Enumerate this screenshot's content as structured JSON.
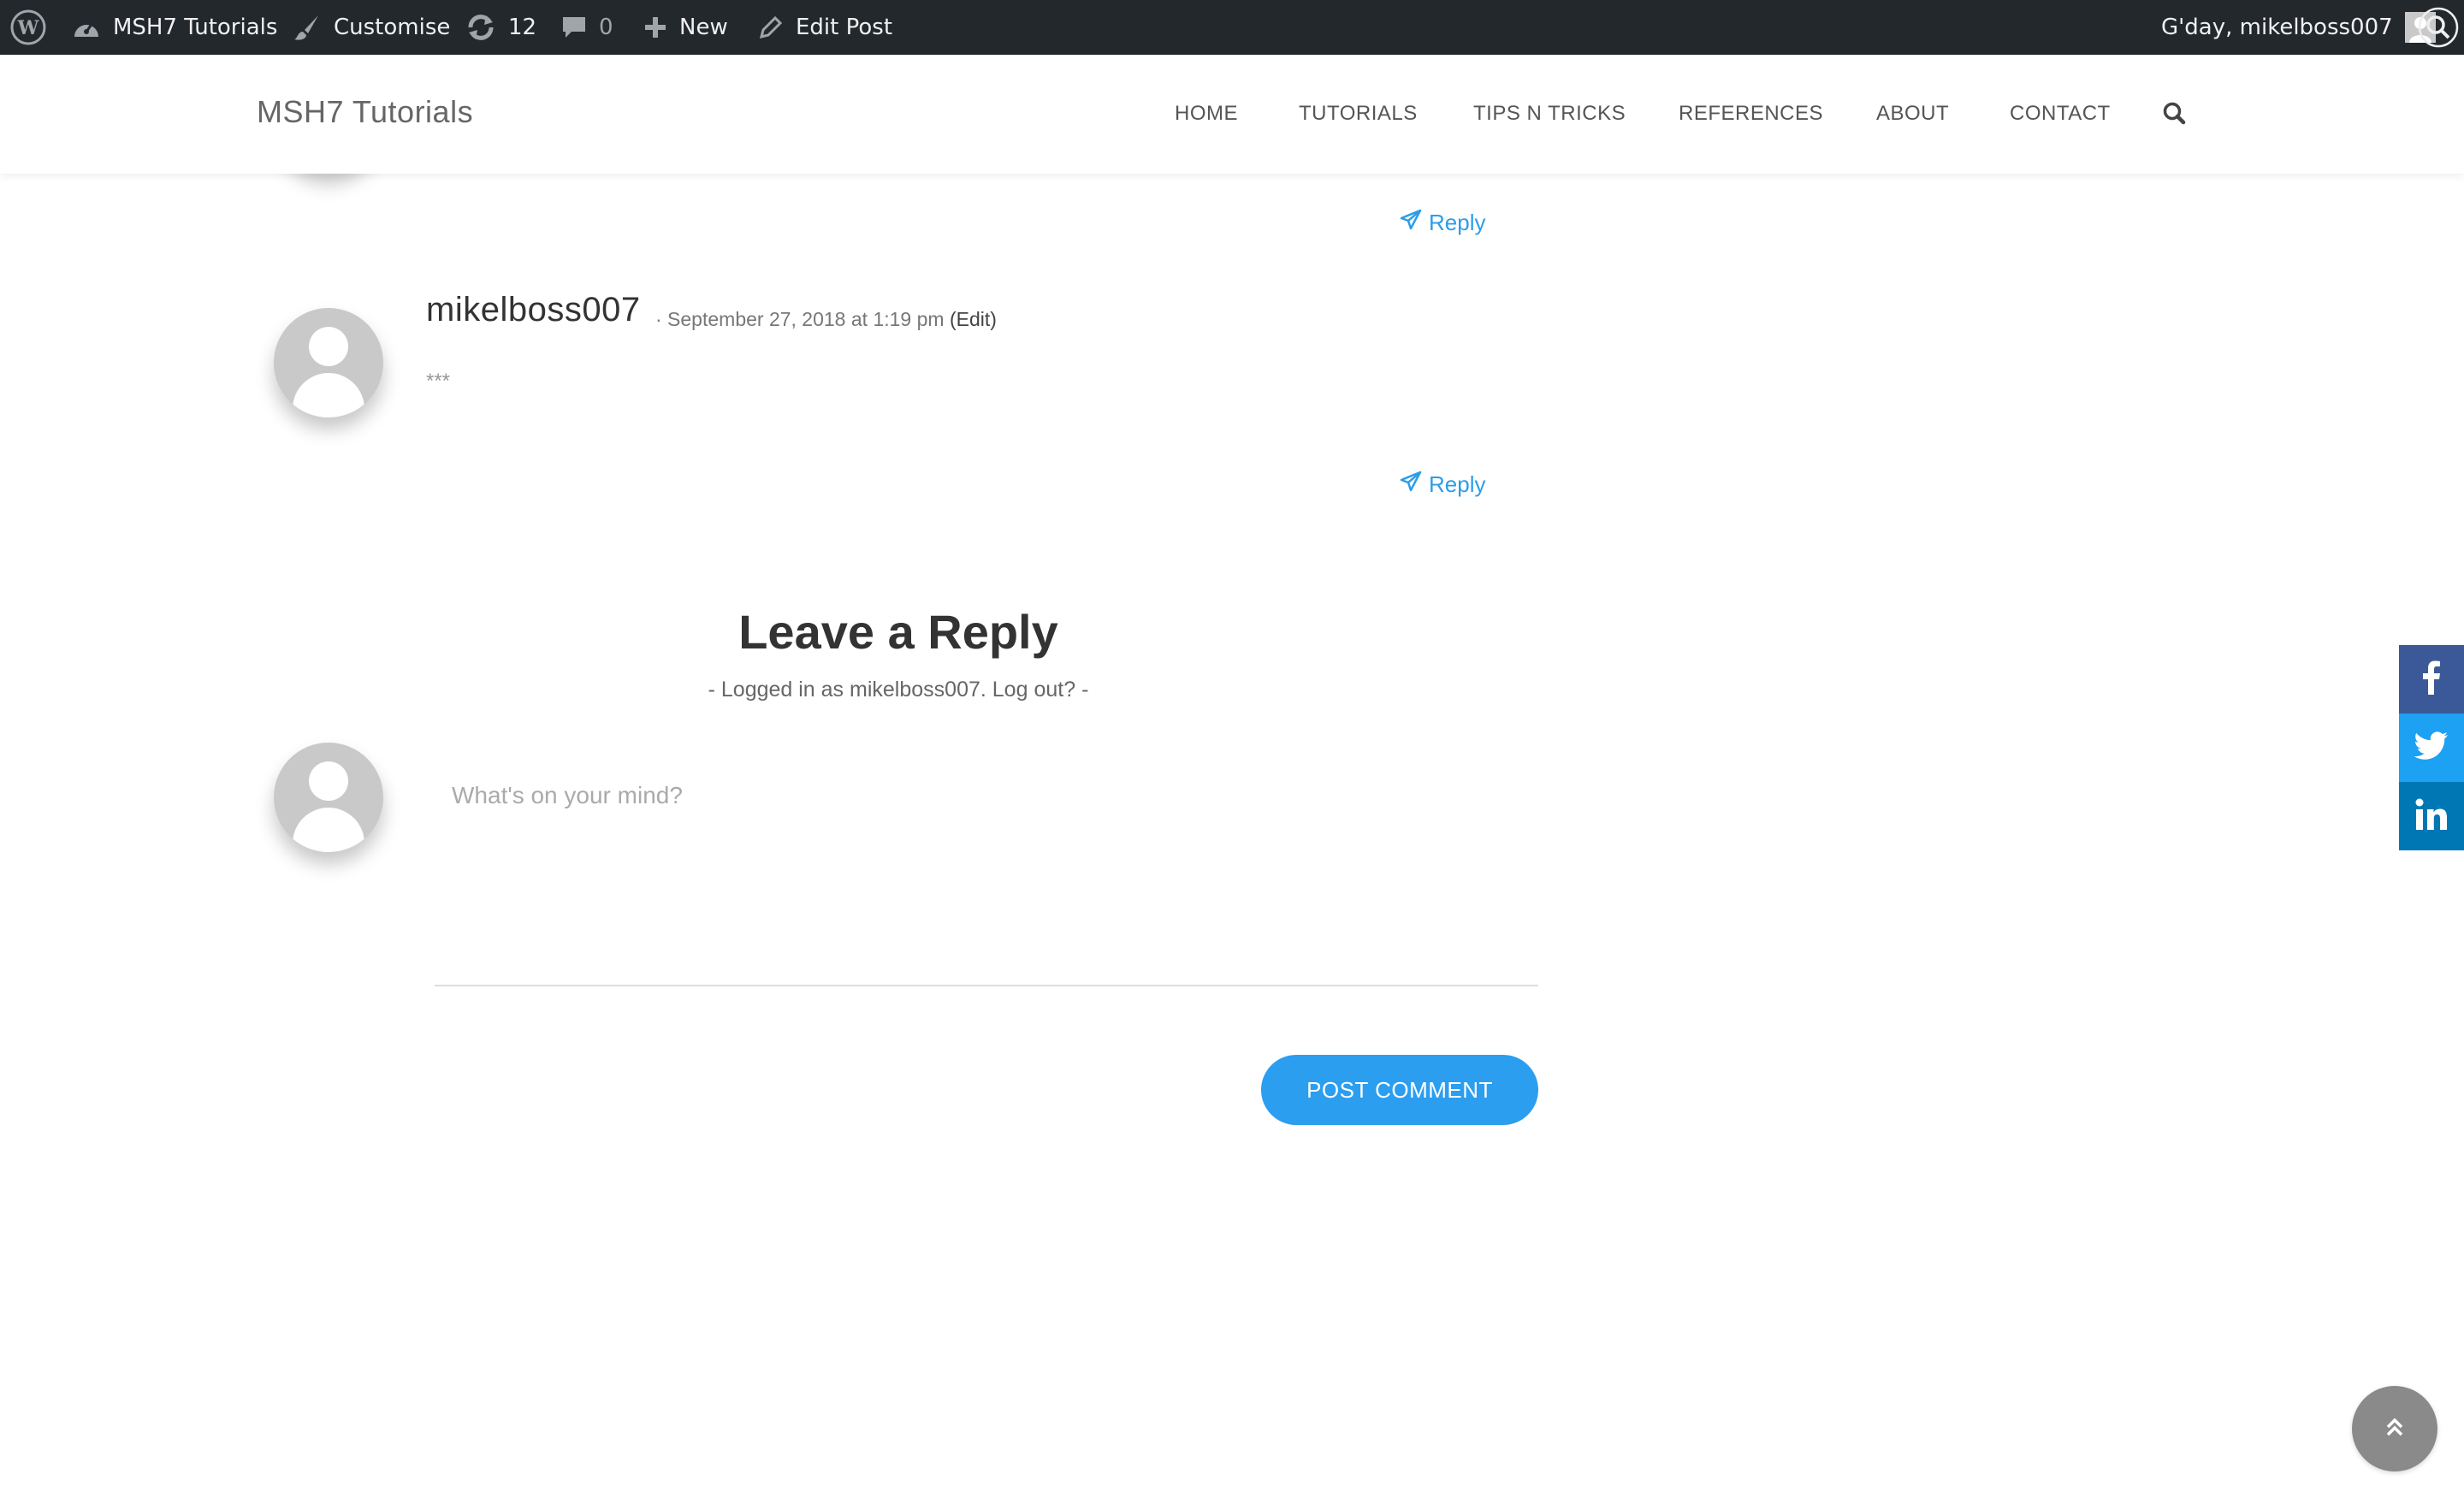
{
  "admin_bar": {
    "site_name": "MSH7 Tutorials",
    "customise": "Customise",
    "updates_count": "12",
    "comments_count": "0",
    "new": "New",
    "edit_post": "Edit Post",
    "greeting": "G'day, mikelboss007"
  },
  "header": {
    "site_title": "MSH7 Tutorials",
    "nav": [
      "HOME",
      "TUTORIALS",
      "TIPS N TRICKS",
      "REFERENCES",
      "ABOUT",
      "CONTACT"
    ]
  },
  "comments": {
    "reply_label": "Reply",
    "items": [
      {
        "author": "mikelboss007",
        "meta": "· September 27, 2018 at 1:19 pm",
        "edit": "(Edit)",
        "text": "***"
      }
    ]
  },
  "reply_form": {
    "title": "Leave a Reply",
    "logged_in_prefix": "- Logged in as",
    "logged_in_user": "mikelboss007.",
    "logout": "Log out?",
    "logged_in_suffix": "-",
    "placeholder": "What's on your mind?",
    "submit": "POST COMMENT"
  },
  "social": {
    "icons": [
      "facebook-icon",
      "twitter-icon",
      "linkedin-icon"
    ],
    "colors": {
      "facebook": "#3b5998",
      "twitter": "#1da1f2",
      "linkedin": "#0077b5"
    }
  },
  "colors": {
    "accent": "#2b9ef0",
    "admin_bar": "#23282d"
  }
}
